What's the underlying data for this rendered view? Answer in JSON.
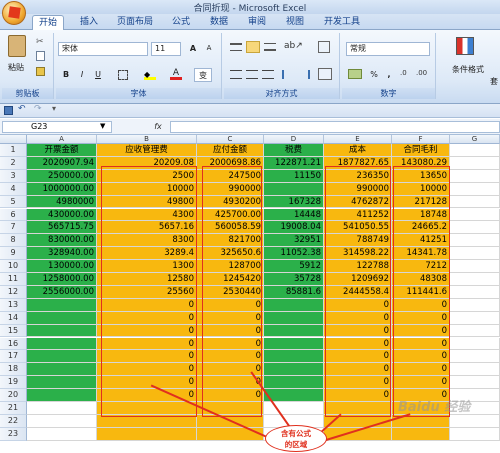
{
  "window": {
    "title": "合同折现 - Microsoft Excel"
  },
  "tabs": [
    "开始",
    "插入",
    "页面布局",
    "公式",
    "数据",
    "审阅",
    "视图",
    "开发工具"
  ],
  "ribbon": {
    "clipboard": {
      "paste": "粘贴",
      "label": "剪贴板"
    },
    "font": {
      "name": "宋体",
      "size": "11",
      "grow": "A",
      "shrink": "A",
      "bold": "B",
      "italic": "I",
      "underline": "U",
      "wen": "变",
      "label": "字体"
    },
    "alignment": {
      "label": "对齐方式"
    },
    "number": {
      "format": "常规",
      "percent": "%",
      "comma": ",",
      "label": "数字"
    },
    "styles": {
      "conditional": "条件格式",
      "label": "套"
    }
  },
  "formula_bar": {
    "name_box": "G23",
    "fx": "fx",
    "value": ""
  },
  "columns": [
    "A",
    "B",
    "C",
    "D",
    "E",
    "F",
    "G"
  ],
  "rows": [
    "1",
    "2",
    "3",
    "4",
    "5",
    "6",
    "7",
    "8",
    "9",
    "10",
    "11",
    "12",
    "13",
    "14",
    "15",
    "16",
    "17",
    "18",
    "19",
    "20",
    "21",
    "22",
    "23"
  ],
  "headers": {
    "A": "开票金额",
    "B": "应收管理费",
    "C": "应付金额",
    "D": "税费",
    "E": "成本",
    "F": "合同毛利"
  },
  "data": {
    "A": [
      "2020907.94",
      "250000.00",
      "1000000.00",
      "4980000",
      "430000.00",
      "565715.75",
      "830000.00",
      "328940.00",
      "130000.00",
      "1258000.00",
      "2556000.00"
    ],
    "B": [
      "20209.08",
      "2500",
      "10000",
      "49800",
      "4300",
      "5657.16",
      "8300",
      "3289.4",
      "1300",
      "12580",
      "25560",
      "0",
      "0",
      "0",
      "0",
      "0",
      "0",
      "0",
      "0"
    ],
    "C": [
      "2000698.86",
      "247500",
      "990000",
      "4930200",
      "425700.00",
      "560058.59",
      "821700",
      "325650.6",
      "128700",
      "1245420",
      "2530440",
      "0",
      "0",
      "0",
      "0",
      "0",
      "0",
      "0",
      "0"
    ],
    "D": [
      "122871.21",
      "11150",
      "",
      "167328",
      "14448",
      "19008.04",
      "32951",
      "11052.38",
      "5912",
      "35728",
      "85881.6"
    ],
    "E": [
      "1877827.65",
      "236350",
      "990000",
      "4762872",
      "411252",
      "541050.55",
      "788749",
      "314598.22",
      "122788",
      "1209692",
      "2444558.4",
      "0",
      "0",
      "0",
      "0",
      "0",
      "0",
      "0",
      "0"
    ],
    "F": [
      "143080.29",
      "13650",
      "10000",
      "217128",
      "18748",
      "24665.2",
      "41251",
      "14341.78",
      "7212",
      "48308",
      "111441.6",
      "0",
      "0",
      "0",
      "0",
      "0",
      "0",
      "0",
      "0"
    ]
  },
  "annotation": {
    "line1": "含有公式",
    "line2": "的区域"
  },
  "watermark": "Baidu 经验",
  "colors": {
    "green": "#2bb04a",
    "orange": "#f8b80f",
    "red": "#e0301e"
  }
}
